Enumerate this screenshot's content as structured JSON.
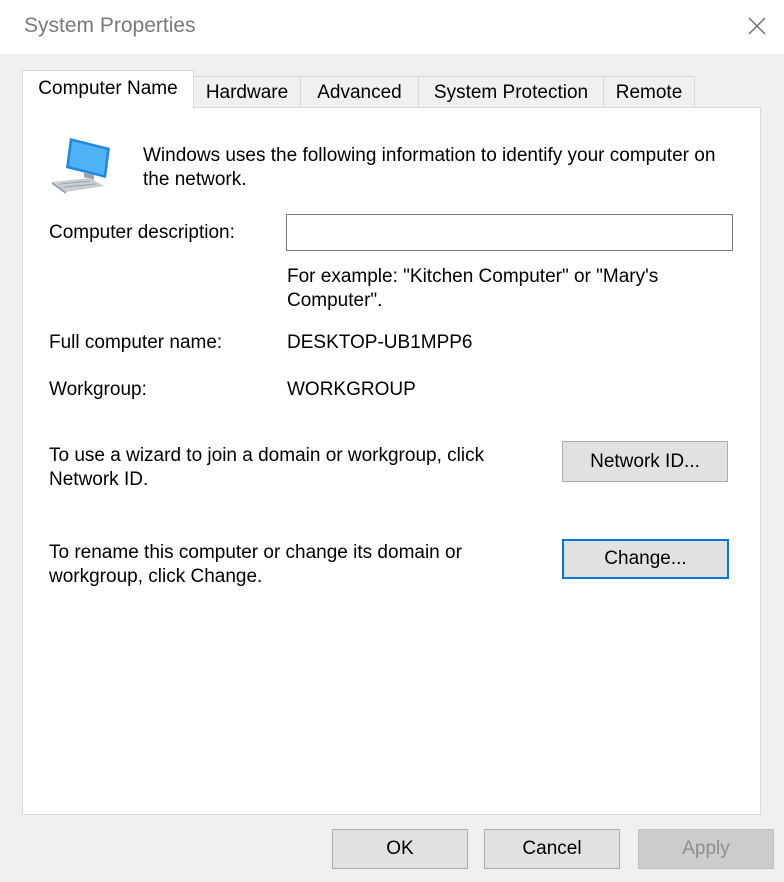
{
  "window": {
    "title": "System Properties",
    "close_label": "×"
  },
  "tabs": [
    {
      "label": "Computer Name",
      "active": true
    },
    {
      "label": "Hardware",
      "active": false
    },
    {
      "label": "Advanced",
      "active": false
    },
    {
      "label": "System Protection",
      "active": false
    },
    {
      "label": "Remote",
      "active": false
    }
  ],
  "computer_name": {
    "intro": "Windows uses the following information to identify your computer on the network.",
    "description_label": "Computer description:",
    "description_value": "",
    "description_placeholder": "",
    "example": "For example: \"Kitchen Computer\" or \"Mary's Computer\".",
    "full_name_label": "Full computer name:",
    "full_name_value": "DESKTOP-UB1MPP6",
    "workgroup_label": "Workgroup:",
    "workgroup_value": "WORKGROUP",
    "network_id_text": "To use a wizard to join a domain or workgroup, click Network ID.",
    "network_id_button": "Network ID...",
    "rename_text": "To rename this computer or change its domain or workgroup, click Change.",
    "change_button": "Change..."
  },
  "footer": {
    "ok_label": "OK",
    "cancel_label": "Cancel",
    "apply_label": "Apply"
  },
  "icons": {
    "computer": "computer-icon",
    "close": "close-icon"
  },
  "colors": {
    "focus_border": "#0078d7",
    "title_text": "#7a7a7a",
    "dialog_background": "#f0f0f0"
  }
}
